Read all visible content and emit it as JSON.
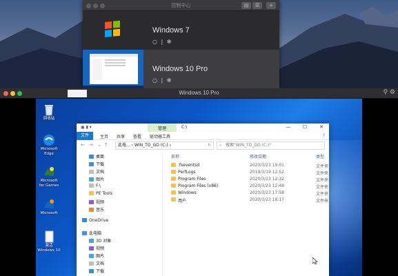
{
  "control_center": {
    "title": "控制中心",
    "vms": [
      {
        "name": "Windows 7",
        "power_icon": "power-icon",
        "settings_icon": "gear-icon",
        "separator": "|"
      },
      {
        "name": "Windows 10 Pro",
        "power_icon": "power-icon",
        "settings_icon": "gear-icon",
        "separator": "|"
      }
    ]
  },
  "vm_window": {
    "title": "Windows 10 Pro"
  },
  "desktop_icons": [
    {
      "label": "回收站",
      "icon": "recycle-bin-icon"
    },
    {
      "label": "Microsoft Edge",
      "icon": "edge-icon"
    },
    {
      "label": "Microsoft for Games",
      "icon": "app-icon"
    },
    {
      "label": "Microsoft",
      "icon": "app-icon"
    },
    {
      "label": "激活Windows 10",
      "icon": "document-icon"
    }
  ],
  "explorer": {
    "manage_tab": "管理",
    "title_path": "C:\\",
    "ribbon": {
      "file": "文件",
      "home": "主页",
      "share": "共享",
      "view": "查看",
      "drive_tools": "驱动器工具"
    },
    "address": "此电... › WIN_TO_GO (C:) ›",
    "search_placeholder": "搜索\"WIN_TO_GO (C:)\"",
    "nav_items": [
      {
        "label": "桌面",
        "pinned": true
      },
      {
        "label": "下载",
        "pinned": true
      },
      {
        "label": "文档",
        "pinned": true
      },
      {
        "label": "图片",
        "pinned": true
      },
      {
        "label": "F:\\",
        "pinned": false
      },
      {
        "label": "PE Tools",
        "pinned": false
      },
      {
        "label": "视频",
        "pinned": false
      },
      {
        "label": "音乐",
        "pinned": false
      },
      {
        "label": "OneDrive",
        "pinned": false
      },
      {
        "label": "此电脑",
        "pinned": false
      },
      {
        "label": "3D 对象",
        "pinned": false
      },
      {
        "label": "视频",
        "pinned": false
      },
      {
        "label": "图片",
        "pinned": false
      },
      {
        "label": "文档",
        "pinned": false
      },
      {
        "label": "下载",
        "pinned": false
      }
    ],
    "columns": {
      "name": "名称",
      "date": "修改日期",
      "type": "类型"
    },
    "files": [
      {
        "name": ".fseventsd",
        "date": "2020/3/23 19:01",
        "type": "文件夹"
      },
      {
        "name": "PerfLogs",
        "date": "2019/3/19 12:52",
        "type": "文件夹"
      },
      {
        "name": "Program Files",
        "date": "2020/3/23 12:32",
        "type": "文件夹"
      },
      {
        "name": "Program Files (x86)",
        "date": "2020/3/23 12:48",
        "type": "文件夹"
      },
      {
        "name": "Windows",
        "date": "2020/3/23 17:58",
        "type": "文件夹"
      },
      {
        "name": "用户",
        "date": "2020/3/23 18:17",
        "type": "文件夹"
      }
    ]
  }
}
